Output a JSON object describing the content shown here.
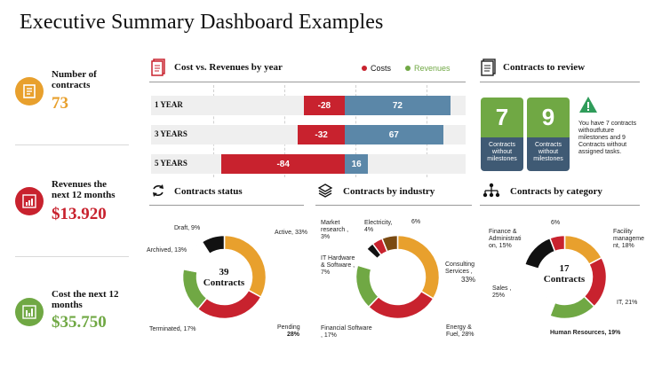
{
  "title": "Executive Summary Dashboard Examples",
  "kpis": [
    {
      "label": "Number of contracts",
      "value": "73",
      "color": "#e8a02d"
    },
    {
      "label": "Revenues the next 12 months",
      "value": "$13.920",
      "color": "#c8222e"
    },
    {
      "label": "Cost the next 12  months",
      "value": "$35.750",
      "color": "#70a844"
    }
  ],
  "cost_rev": {
    "title": "Cost vs. Revenues by year",
    "legend_costs": "Costs",
    "legend_revenues": "Revenues",
    "colors": {
      "costs": "#c8222e",
      "revenues": "#5b87a8"
    },
    "rows": [
      {
        "label": "1 YEAR",
        "cost": -28,
        "rev": 72,
        "cost_text": "-28",
        "rev_text": "72"
      },
      {
        "label": "3 YEARS",
        "cost": -32,
        "rev": 67,
        "cost_text": "-32",
        "rev_text": "67"
      },
      {
        "label": "5 YEARS",
        "cost": -84,
        "rev": 16,
        "cost_text": "-84",
        "rev_text": "16"
      }
    ]
  },
  "review": {
    "title": "Contracts to review",
    "tiles": [
      {
        "value": "7",
        "label": "Contracts without milestones"
      },
      {
        "value": "9",
        "label": "Contracts without milestones"
      }
    ],
    "note": "You have 7 contracts withoutfuture milestones and 9 Contracts without assigned tasks."
  },
  "status": {
    "title": "Contracts status",
    "center_value": "39",
    "center_label": "Contracts",
    "labels": {
      "draft": "Draft, 9%",
      "active": "Active, 33%",
      "archived": "Archived, 13%",
      "terminated": "Terminated, 17%",
      "pending": "Pending",
      "pending_pct": "28%"
    }
  },
  "industry": {
    "title": "Contracts by industry",
    "labels": {
      "market": "Market research , 3%",
      "electricity": "Electricity, 4%",
      "six": "6%",
      "it": "IT Hardware & Software , 7%",
      "consulting": "Consulting Services ,",
      "consulting_pct": "33%",
      "financial": "Financial Software , 17%",
      "energy": "Energy & Fuel, 28%"
    }
  },
  "category": {
    "title": "Contracts by category",
    "center_value": "17",
    "center_label": "Contracts",
    "labels": {
      "finance": "Finance & Administrati on, 15%",
      "six": "6%",
      "facility": "Facility manageme nt, 18%",
      "sales": "Sales , 25%",
      "it": "IT, 21%",
      "hr": "Human Resources, 19%"
    }
  },
  "chart_data": [
    {
      "type": "bar",
      "title": "Cost vs. Revenues by year",
      "categories": [
        "1 YEAR",
        "3 YEARS",
        "5 YEARS"
      ],
      "series": [
        {
          "name": "Costs",
          "values": [
            -28,
            -32,
            -84
          ]
        },
        {
          "name": "Revenues",
          "values": [
            72,
            67,
            16
          ]
        }
      ]
    },
    {
      "type": "pie",
      "title": "Contracts status",
      "categories": [
        "Active",
        "Pending",
        "Terminated",
        "Archived",
        "Draft"
      ],
      "values": [
        33,
        28,
        17,
        13,
        9
      ]
    },
    {
      "type": "pie",
      "title": "Contracts by industry",
      "categories": [
        "Consulting Services",
        "Energy & Fuel",
        "Financial Software",
        "IT Hardware & Software",
        "Market research",
        "Electricity",
        ""
      ],
      "values": [
        33,
        28,
        17,
        7,
        3,
        4,
        6
      ]
    },
    {
      "type": "pie",
      "title": "Contracts by category",
      "categories": [
        "Facility management",
        "IT",
        "Human Resources",
        "Sales",
        "Finance & Administration",
        ""
      ],
      "values": [
        18,
        21,
        19,
        25,
        15,
        6
      ]
    }
  ]
}
